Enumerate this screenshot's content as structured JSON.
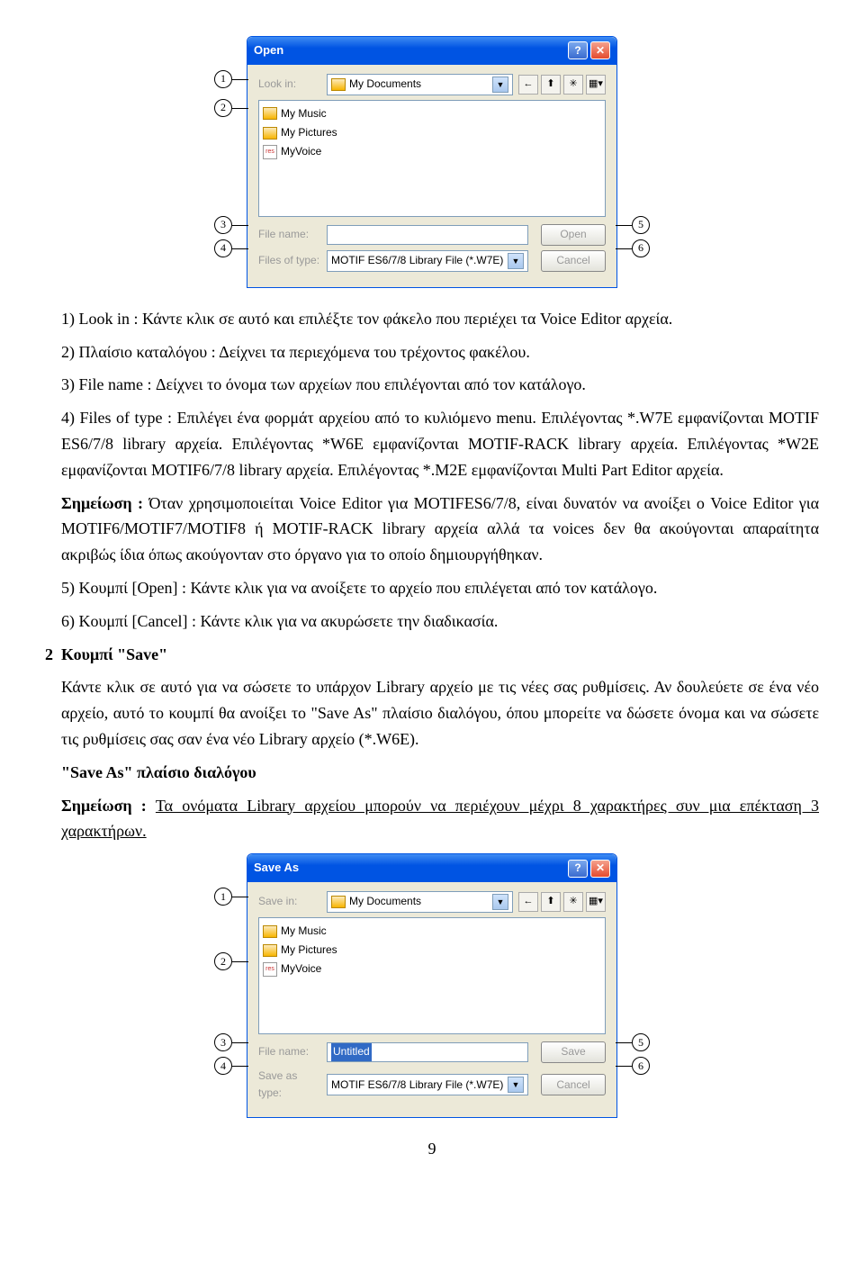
{
  "dialog_open": {
    "title": "Open",
    "lookin_label": "Look in:",
    "lookin_value": "My Documents",
    "files": [
      "My Music",
      "My Pictures",
      "MyVoice"
    ],
    "filename_label": "File name:",
    "filename_value": "",
    "filetype_label": "Files of type:",
    "filetype_value": "MOTIF ES6/7/8 Library File (*.W7E)",
    "open_btn": "Open",
    "cancel_btn": "Cancel",
    "callouts": {
      "c1": "1",
      "c2": "2",
      "c3": "3",
      "c4": "4",
      "c5": "5",
      "c6": "6"
    }
  },
  "dialog_save": {
    "title": "Save As",
    "savein_label": "Save in:",
    "savein_value": "My Documents",
    "files": [
      "My Music",
      "My Pictures",
      "MyVoice"
    ],
    "filename_label": "File name:",
    "filename_value": "Untitled",
    "saveas_label": "Save as type:",
    "saveas_value": "MOTIF ES6/7/8 Library File (*.W7E)",
    "save_btn": "Save",
    "cancel_btn": "Cancel",
    "callouts": {
      "c1": "1",
      "c2": "2",
      "c3": "3",
      "c4": "4",
      "c5": "5",
      "c6": "6"
    }
  },
  "text": {
    "p1": "1) Look in : Κάντε κλικ σε αυτό και επιλέξτε τον φάκελο που περιέχει τα Voice Editor αρχεία.",
    "p2": "2) Πλαίσιο καταλόγου : Δείχνει τα περιεχόμενα του τρέχοντος φακέλου.",
    "p3": "3) File name : Δείχνει το όνομα των αρχείων που επιλέγονται από τον κατάλογο.",
    "p4": "4) Files of type : Επιλέγει ένα φορμάτ αρχείου από το κυλιόμενο menu. Επιλέγοντας *.W7E εμφανίζονται MOTIF ES6/7/8 library αρχεία. Επιλέγοντας *W6E εμφανίζονται MOTIF-RACK library αρχεία. Επιλέγοντας *W2E εμφανίζονται MOTIF6/7/8 library αρχεία. Επιλέγοντας *.M2E εμφανίζονται Multi Part Editor αρχεία.",
    "p5a": "Σημείωση : ",
    "p5b": "Όταν χρησιμοποιείται Voice Editor για MOTIFES6/7/8, είναι δυνατόν να ανοίξει ο Voice Editor για MOTIF6/MOTIF7/MOTIF8 ή MOTIF-RACK library αρχεία αλλά τα voices δεν θα ακούγονται απαραίτητα ακριβώς ίδια όπως ακούγονταν στο όργανο για το οποίο δημιουργήθηκαν.",
    "p6": "5) Κουμπί [Open] : Κάντε κλικ για να ανοίξετε το αρχείο που επιλέγεται από τον κατάλογο.",
    "p7": "6) Κουμπί [Cancel] : Κάντε κλικ για να ακυρώσετε την διαδικασία.",
    "h2_num": "2",
    "h2": "Κουμπί \"Save\"",
    "p8": "Κάντε κλικ σε αυτό για να σώσετε το υπάρχον Library αρχείο με τις νέες σας ρυθμίσεις. Αν δουλεύετε σε ένα νέο αρχείο, αυτό το κουμπί θα ανοίξει το \"Save As\" πλαίσιο διαλόγου, όπου μπορείτε να δώσετε όνομα και να σώσετε τις ρυθμίσεις σας σαν ένα νέο Library αρχείο (*.W6E).",
    "h3": "\"Save As\" πλαίσιο διαλόγου",
    "p9a": "Σημείωση : ",
    "p9b": "Τα ονόματα Library αρχείου μπορούν να περιέχουν μέχρι 8 χαρακτήρες συν μια επέκταση 3 χαρακτήρων.",
    "page": "9"
  }
}
